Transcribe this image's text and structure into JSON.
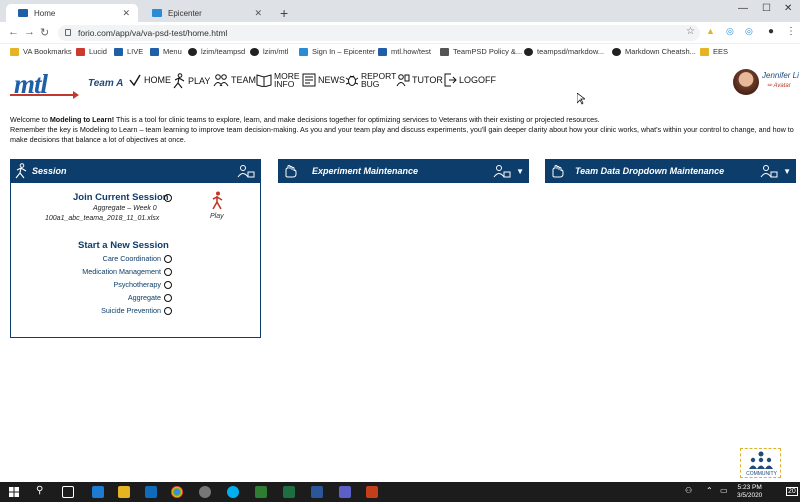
{
  "browser": {
    "tabs": [
      {
        "label": "Home",
        "favicon_color": "#1f5fa8"
      },
      {
        "label": "Epicenter",
        "favicon_color": "#2b8cd6"
      }
    ],
    "url": "forio.com/app/va/va-psd-test/home.html",
    "bookmarks": [
      {
        "label": "VA Bookmarks",
        "color": "#e6b422"
      },
      {
        "label": "Lucid",
        "color": "#cc3a2f"
      },
      {
        "label": "LIVE",
        "color": "#1f5fa8"
      },
      {
        "label": "Menu",
        "color": "#1f5fa8"
      },
      {
        "label": "lzim/teampsd",
        "color": "#222"
      },
      {
        "label": "lzim/mtl",
        "color": "#222"
      },
      {
        "label": "Sign In – Epicenter",
        "color": "#2b8cd6"
      },
      {
        "label": "mtl.how/test",
        "color": "#1f5fa8"
      },
      {
        "label": "TeamPSD Policy &...",
        "color": "#555"
      },
      {
        "label": "teampsd/markdow...",
        "color": "#222"
      },
      {
        "label": "Markdown Cheatsh...",
        "color": "#222"
      },
      {
        "label": "EES",
        "color": "#e6b422"
      }
    ]
  },
  "app": {
    "logo_text": "mtl",
    "team": "Team A",
    "nav": [
      {
        "label": "HOME",
        "icon": "check-icon"
      },
      {
        "label": "PLAY",
        "icon": "runner-icon"
      },
      {
        "label": "TEAM",
        "icon": "team-icon"
      },
      {
        "label1": "MORE",
        "label2": "INFO",
        "icon": "book-icon"
      },
      {
        "label": "NEWS",
        "icon": "news-icon"
      },
      {
        "label1": "REPORT",
        "label2": "BUG",
        "icon": "bug-icon"
      },
      {
        "label": "TUTOR",
        "icon": "tutor-icon"
      },
      {
        "label": "LOGOFF",
        "icon": "logoff-icon"
      }
    ],
    "user": {
      "name": "Jennifer Li",
      "sub": "✏ Avatar"
    },
    "welcome": {
      "line1_pre": "Welcome to ",
      "line1_bold": "Modeling to Learn!",
      "line1_post": " This is a tool for clinic teams to explore, learn, and make decisions together for optimizing services to Veterans with their existing or projected resources.",
      "line2": "Remember the key is Modeling to Learn – team learning to improve team decision-making. As you and your team play and discuss experiments, you'll gain deeper clarity about how your clinic works, what's within your control to change, and how to make decisions that balance a lot of objectives at once."
    },
    "panels": {
      "session": "Session",
      "experiment": "Experiment Maintenance",
      "team_data": "Team Data Dropdown Maintenance"
    },
    "session": {
      "join_title": "Join Current Session",
      "join_sub": "Aggregate – Week 0",
      "join_file": "100a1_abc_teama_2018_11_01.xlsx",
      "play_label": "Play",
      "new_title": "Start a New Session",
      "options": [
        "Care Coordination",
        "Medication Management",
        "Psychotherapy",
        "Aggregate",
        "Suicide Prevention"
      ]
    },
    "community_label": "COMMUNITY"
  },
  "taskbar": {
    "time": "5:23 PM",
    "date": "3/5/2020"
  },
  "colors": {
    "navy": "#0d3d6b",
    "logo_blue": "#1f5fa8",
    "accent_red": "#c0392b"
  }
}
